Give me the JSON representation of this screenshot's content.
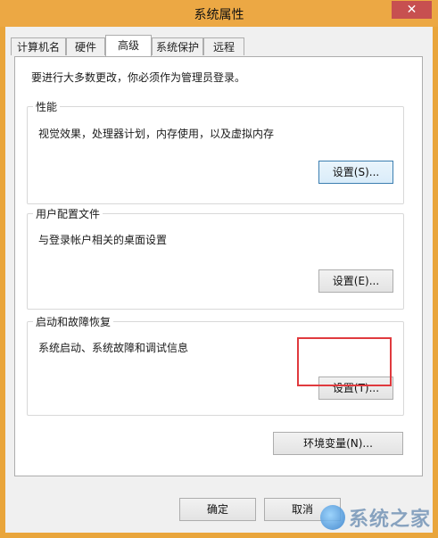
{
  "window": {
    "title": "系统属性",
    "close_label": "✕"
  },
  "tabs": [
    {
      "label": "计算机名"
    },
    {
      "label": "硬件"
    },
    {
      "label": "高级"
    },
    {
      "label": "系统保护"
    },
    {
      "label": "远程"
    }
  ],
  "active_tab": "高级",
  "notice": "要进行大多数更改，你必须作为管理员登录。",
  "groups": {
    "performance": {
      "title": "性能",
      "description": "视觉效果，处理器计划，内存使用，以及虚拟内存",
      "button": "设置(S)..."
    },
    "profile": {
      "title": "用户配置文件",
      "description": "与登录帐户相关的桌面设置",
      "button": "设置(E)..."
    },
    "startup": {
      "title": "启动和故障恢复",
      "description": "系统启动、系统故障和调试信息",
      "button": "设置(T)..."
    }
  },
  "env_button": "环境变量(N)...",
  "footer": {
    "ok_label": "确定",
    "cancel_label": "取消"
  },
  "watermark": {
    "text": "系统之家"
  },
  "colors": {
    "highlight": "#e03a3e",
    "titlebar": "#eca844"
  }
}
